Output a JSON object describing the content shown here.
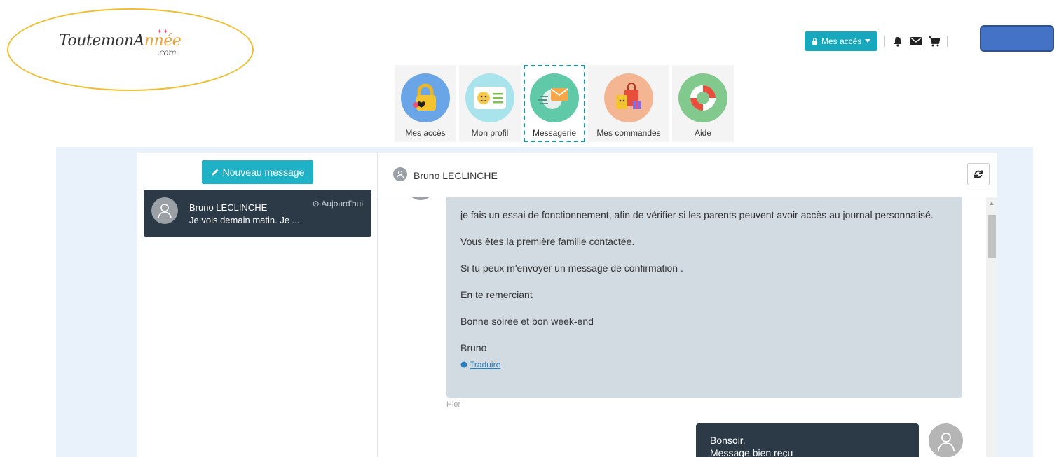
{
  "logo": {
    "part1": "ToutemonA",
    "part2": "nnée",
    "suffix": ".com"
  },
  "header": {
    "access_button": "Mes accès",
    "icons": [
      "bell-icon",
      "envelope-icon",
      "cart-icon"
    ]
  },
  "appnav": [
    {
      "label": "Mes accès",
      "icon": "padlock-icon",
      "color": "#6aa5e8"
    },
    {
      "label": "Mon profil",
      "icon": "profile-card-icon",
      "color": "#a9e4ec"
    },
    {
      "label": "Messagerie",
      "icon": "mail-icon",
      "color": "#5fc9a8",
      "active": true
    },
    {
      "label": "Mes commandes",
      "icon": "shopping-bag-icon",
      "color": "#f3b592"
    },
    {
      "label": "Aide",
      "icon": "lifebuoy-icon",
      "color": "#82c98d"
    }
  ],
  "sidebar": {
    "new_message_label": "Nouveau message",
    "conversations": [
      {
        "name": "Bruno LECLINCHE",
        "time": "Aujourd'hui",
        "preview": "Je vois demain matin. Je ..."
      }
    ]
  },
  "conversation": {
    "contact_name": "Bruno LECLINCHE",
    "incoming": {
      "paragraphs": [
        "je fais un essai de fonctionnement, afin de vérifier si les parents peuvent avoir accès au journal personnalisé.",
        "Vous êtes la première famille contactée.",
        "Si tu peux m'envoyer un message de confirmation .",
        "En te remerciant",
        "Bonne soirée et bon week-end",
        "Bruno"
      ],
      "translate_label": "Traduire",
      "time": "Hier"
    },
    "outgoing": {
      "line1": "Bonsoir,",
      "line2": "Message bien reçu"
    }
  },
  "colors": {
    "accent": "#17a8bd",
    "dark_bubble": "#2c3a47",
    "incoming_bubble": "#d3dbe2",
    "logo_ellipse": "#f2bd2e",
    "highlight_box": "#4472c4"
  }
}
